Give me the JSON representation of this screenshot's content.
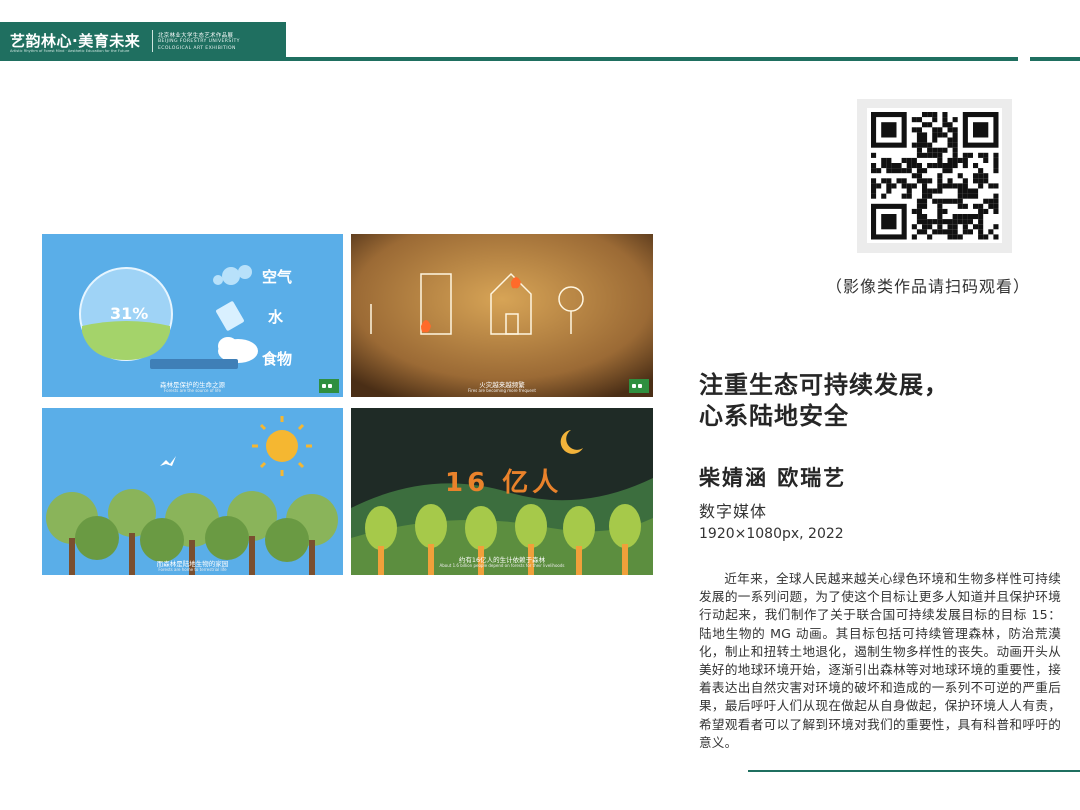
{
  "header": {
    "title": "艺韵林心·美育未来",
    "subtitle": "Artistic Rhythm of Forest Mind · Aesthetic Education for the Future",
    "exhibition_cn": "北京林业大学生态艺术作品展",
    "exhibition_en_1": "BEIJING FORESTRY UNIVERSITY",
    "exhibition_en_2": "ECOLOGICAL ART EXHIBITION"
  },
  "panels": [
    {
      "label_stat": "31%",
      "labels": [
        "空气",
        "水",
        "食物"
      ],
      "caption": "森林是保护的生命之源",
      "caption_en": "Forests are the source of life"
    },
    {
      "caption": "火灾越来越频繁",
      "caption_en": "Fires are becoming more frequent"
    },
    {
      "caption": "而森林是陆地生物的家园",
      "caption_en": "Forests are home to terrestrial life"
    },
    {
      "headline": "16 亿人",
      "caption": "约有16亿人的生计依赖于森林",
      "caption_en": "About 1.6 billion people depend on forests for their livelihoods"
    }
  ],
  "qr": {
    "caption": "（影像类作品请扫码观看）"
  },
  "work": {
    "title_line1": "注重生态可持续发展，",
    "title_line2": "心系陆地安全",
    "authors": "柴婧涵 欧瑞艺",
    "medium": "数字媒体",
    "spec": "1920×1080px, 2022",
    "description": "近年来，全球人民越来越关心绿色环境和生物多样性可持续发展的一系列问题，为了使这个目标让更多人知道并且保护环境行动起来，我们制作了关于联合国可持续发展目标的目标 15：陆地生物的 MG 动画。其目标包括可持续管理森林，防治荒漠化，制止和扭转土地退化，遏制生物多样性的丧失。动画开头从美好的地球环境开始，逐渐引出森林等对地球环境的重要性，接着表达出自然灾害对环境的破坏和造成的一系列不可逆的严重后果，最后呼吁人们从现在做起从自身做起，保护环境人人有责，希望观看者可以了解到环境对我们的重要性，具有科普和呼吁的意义。"
  },
  "colors": {
    "brand_green": "#1f6f60",
    "sky_blue": "#5aaee8",
    "ember_brown": "#b07b3d"
  }
}
